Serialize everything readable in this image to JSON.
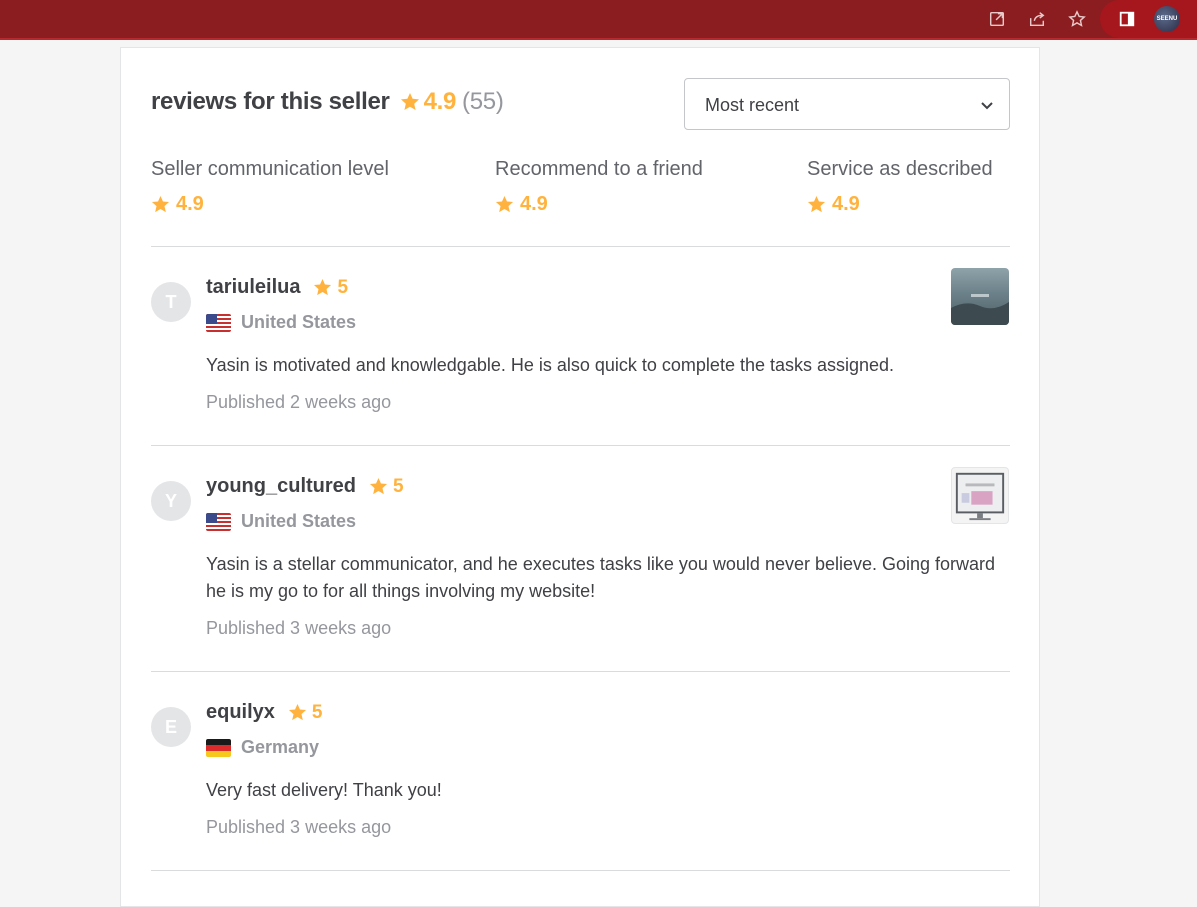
{
  "browser": {
    "icons": [
      "open-external-icon",
      "share-icon",
      "bookmark-star-icon",
      "sidebar-panel-icon"
    ],
    "profile_badge": "SEENU"
  },
  "header": {
    "title": "reviews for this seller",
    "rating": "4.9",
    "count": "(55)"
  },
  "sort": {
    "selected": "Most recent"
  },
  "breakdown": [
    {
      "label": "Seller communication level",
      "value": "4.9"
    },
    {
      "label": "Recommend to a friend",
      "value": "4.9"
    },
    {
      "label": "Service as described",
      "value": "4.9"
    }
  ],
  "reviews": [
    {
      "initial": "T",
      "username": "tariuleilua",
      "rating": "5",
      "country": "United States",
      "text": "Yasin is motivated and knowledgable. He is also quick to complete the tasks assigned.",
      "published": "Published 2 weeks ago"
    },
    {
      "initial": "Y",
      "username": "young_cultured",
      "rating": "5",
      "country": "United States",
      "text": "Yasin is a stellar communicator, and he executes tasks like you would never believe. Going forward he is my go to for all things involving my website!",
      "published": "Published 3 weeks ago"
    },
    {
      "initial": "E",
      "username": "equilyx",
      "rating": "5",
      "country": "Germany",
      "text": "Very fast delivery! Thank you!",
      "published": "Published 3 weeks ago"
    }
  ],
  "colors": {
    "topbar": "#8b1c1f",
    "star": "#ffb33e",
    "text_dark": "#404145",
    "text_muted": "#95979d"
  }
}
